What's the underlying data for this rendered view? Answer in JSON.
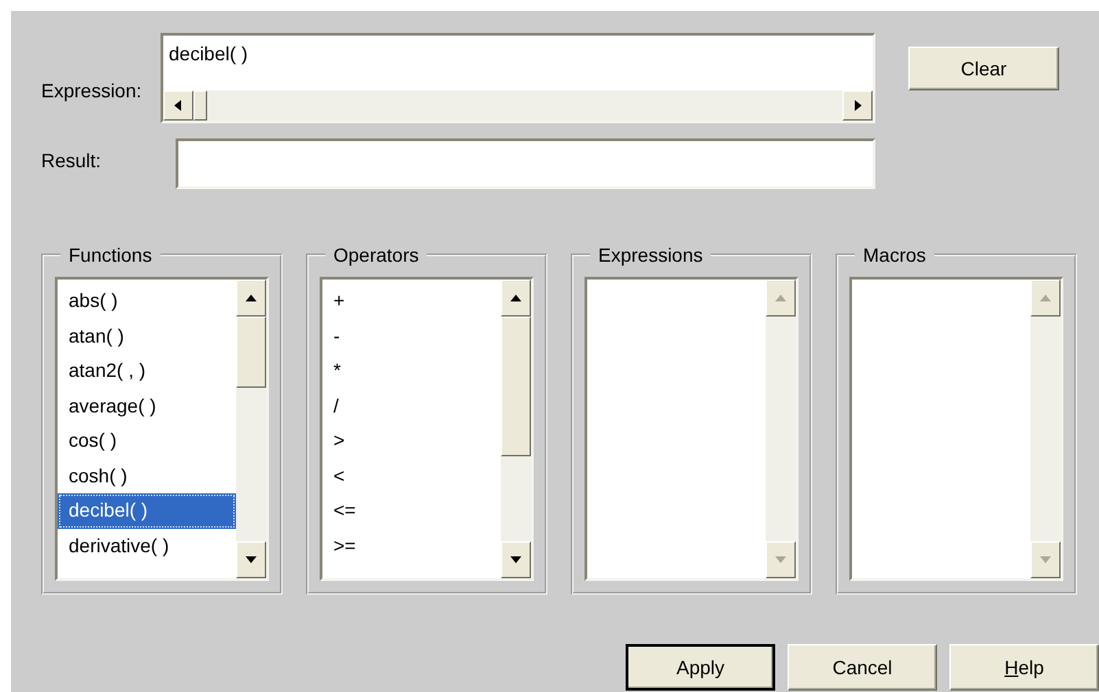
{
  "expression": {
    "label": "Expression:",
    "value": "decibel( )"
  },
  "clear_button": "Clear",
  "result": {
    "label": "Result:"
  },
  "groups": [
    {
      "title": "Functions",
      "disabled": false,
      "items": [
        {
          "text": "abs( )",
          "selected": false
        },
        {
          "text": "atan( )",
          "selected": false
        },
        {
          "text": "atan2( , )",
          "selected": false
        },
        {
          "text": "average( )",
          "selected": false
        },
        {
          "text": "cos( )",
          "selected": false
        },
        {
          "text": "cosh( )",
          "selected": false
        },
        {
          "text": "decibel( )",
          "selected": true
        },
        {
          "text": "derivative( )",
          "selected": false
        }
      ]
    },
    {
      "title": "Operators",
      "disabled": false,
      "items": [
        {
          "text": "+",
          "selected": false
        },
        {
          "text": "-",
          "selected": false
        },
        {
          "text": "*",
          "selected": false
        },
        {
          "text": "/",
          "selected": false
        },
        {
          "text": ">",
          "selected": false
        },
        {
          "text": "<",
          "selected": false
        },
        {
          "text": "<=",
          "selected": false
        },
        {
          "text": ">=",
          "selected": false
        }
      ]
    },
    {
      "title": "Expressions",
      "disabled": true
    },
    {
      "title": "Macros",
      "disabled": true
    }
  ],
  "buttons": [
    {
      "label": "Apply",
      "default": true,
      "first_letter_underlined": false
    },
    {
      "label": "Cancel",
      "default": false,
      "first_letter_underlined": false
    },
    {
      "label": "Help",
      "default": false,
      "first_letter_underlined": true
    }
  ]
}
